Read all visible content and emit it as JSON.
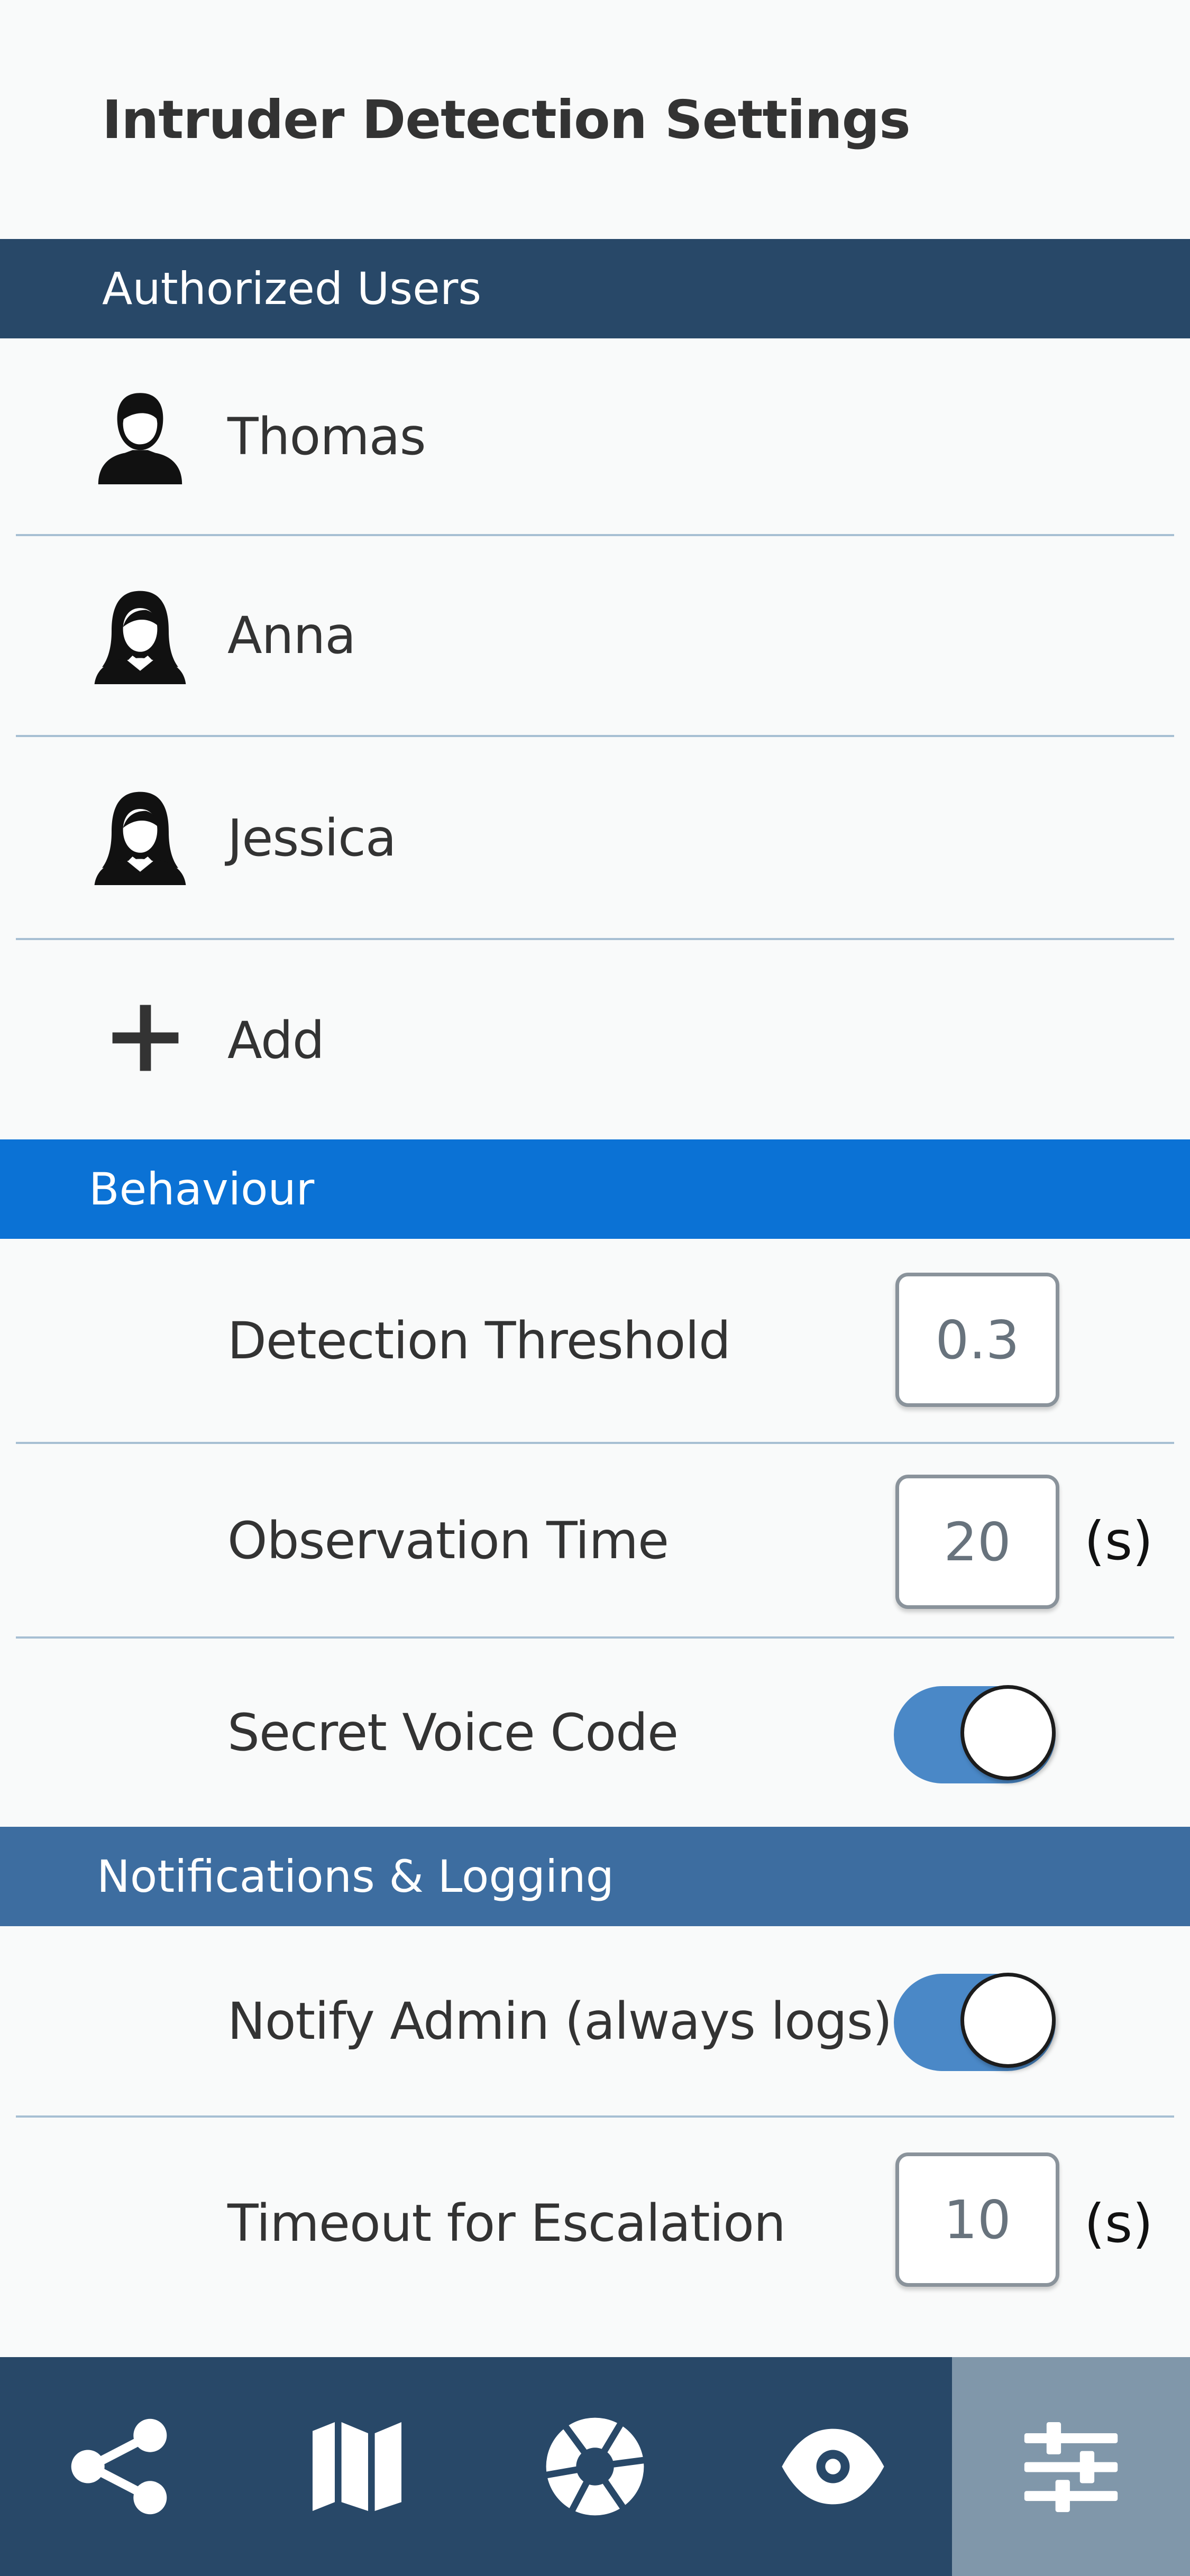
{
  "page": {
    "title": "Intruder Detection Settings"
  },
  "sections": {
    "authorized_users": {
      "title": "Authorized Users",
      "color": "#284868"
    },
    "behaviour": {
      "title": "Behaviour",
      "color": "#0b72d5"
    },
    "notifications": {
      "title": "Notifications & Logging",
      "color": "#3d6da0"
    }
  },
  "users": [
    {
      "name": "Thomas",
      "icon": "male-user-icon"
    },
    {
      "name": "Anna",
      "icon": "female-user-icon"
    },
    {
      "name": "Jessica",
      "icon": "female-user-icon"
    }
  ],
  "add_label": "Add",
  "behaviour": {
    "detection_threshold": {
      "label": "Detection Threshold",
      "value": "0.3"
    },
    "observation_time": {
      "label": "Observation Time",
      "value": "20",
      "unit": "(s)"
    },
    "secret_voice_code": {
      "label": "Secret Voice Code",
      "enabled": true
    }
  },
  "notifications": {
    "notify_admin": {
      "label": "Notify Admin (always logs)",
      "enabled": true
    },
    "timeout_escalation": {
      "label": "Timeout for Escalation",
      "value": "10",
      "unit": "(s)"
    }
  },
  "nav": {
    "items": [
      {
        "icon": "share-icon",
        "active": false
      },
      {
        "icon": "map-icon",
        "active": false
      },
      {
        "icon": "camera-aperture-icon",
        "active": false
      },
      {
        "icon": "eye-icon",
        "active": false
      },
      {
        "icon": "settings-sliders-icon",
        "active": true
      }
    ],
    "background": "#284868",
    "active_background": "#8097aa"
  },
  "colors": {
    "toggle_on": "#4a88c7",
    "divider": "#a7bfd3"
  }
}
